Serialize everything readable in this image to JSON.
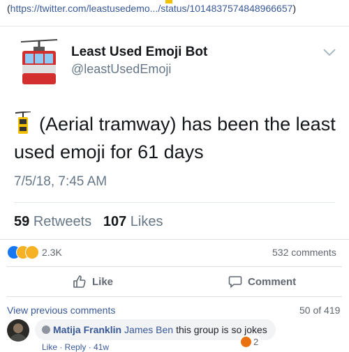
{
  "top_link": {
    "url": "https://twitter.com/leastusedemo.../status/1014837574848966657",
    "open_paren": "(",
    "close_paren": ")"
  },
  "tweet": {
    "display_name": "Least Used Emoji Bot",
    "handle": "@leastUsedEmoji",
    "emoji_name": "aerial-tramway",
    "text": "(Aerial tramway) has been the least used emoji for 61 days",
    "timestamp": "7/5/18, 7:45 AM",
    "retweets_count": "59",
    "retweets_label": "Retweets",
    "likes_count": "107",
    "likes_label": "Likes"
  },
  "post_footer": {
    "reaction_icons": [
      "like",
      "sad",
      "haha"
    ],
    "reactions_count": "2.3K",
    "comments_count": "532 comments",
    "like_label": "Like",
    "comment_label": "Comment"
  },
  "comments": {
    "view_previous": "View previous comments",
    "pager": "50 of 419",
    "items": [
      {
        "author": "Matija Franklin",
        "mention": "James Ben",
        "text": "this group is so jokes",
        "reaction_count": "2",
        "actions": "Like · Reply · 41w"
      }
    ]
  },
  "colors": {
    "link": "#385898",
    "twitter_gray": "#657786",
    "fb_gray": "#606770",
    "bubble": "#f2f3f5"
  }
}
